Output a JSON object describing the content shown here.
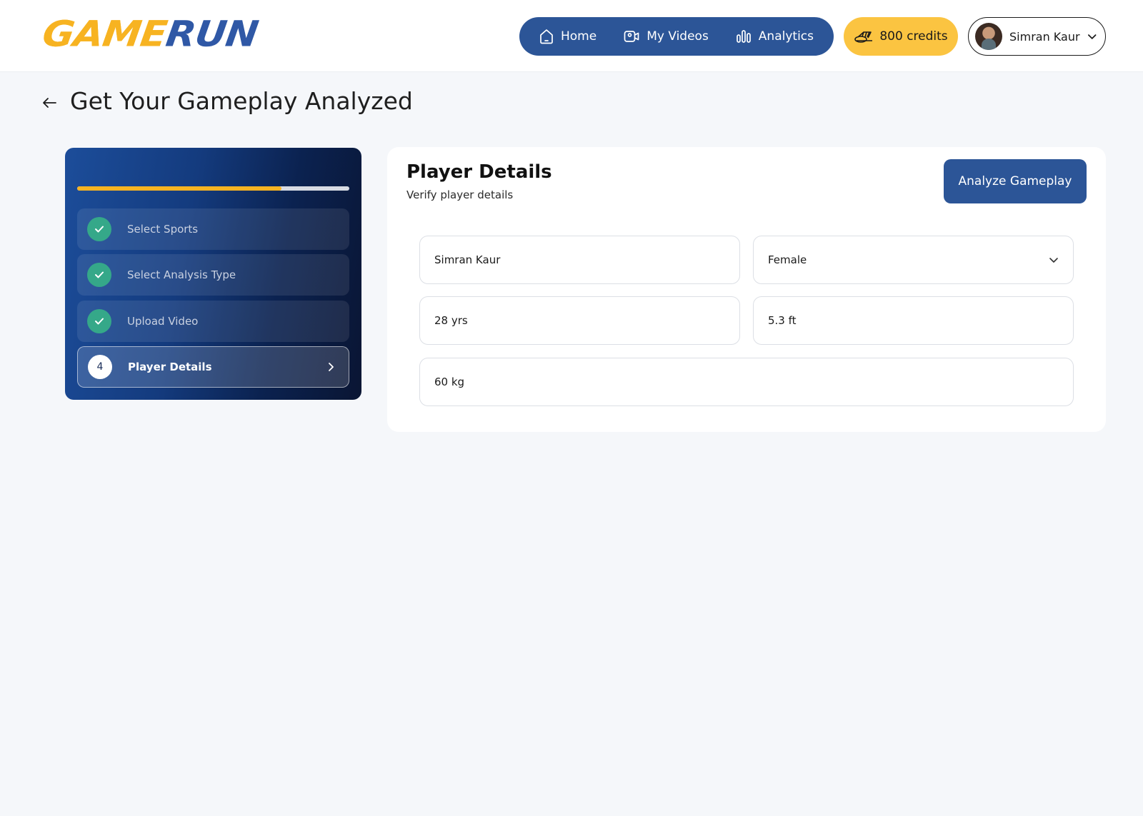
{
  "header": {
    "logo": {
      "part1": "GAME",
      "part2": "RUN"
    },
    "nav": [
      {
        "label": "Home",
        "icon": "home-icon"
      },
      {
        "label": "My Videos",
        "icon": "video-icon"
      },
      {
        "label": "Analytics",
        "icon": "analytics-icon"
      }
    ],
    "credits": {
      "label": "800 credits",
      "icon": "coins-icon"
    },
    "user": {
      "name": "Simran Kaur"
    }
  },
  "page": {
    "title": "Get Your Gameplay Analyzed"
  },
  "steps": {
    "progress_percent": 75,
    "items": [
      {
        "label": "Select Sports",
        "status": "done"
      },
      {
        "label": "Select Analysis Type",
        "status": "done"
      },
      {
        "label": "Upload Video",
        "status": "done"
      },
      {
        "number": "4",
        "label": "Player Details",
        "status": "active"
      }
    ]
  },
  "form": {
    "title": "Player Details",
    "subtitle": "Verify player details",
    "submit_label": "Analyze Gameplay",
    "fields": {
      "name": "Simran Kaur",
      "gender": "Female",
      "age": "28 yrs",
      "height": "5.3 ft",
      "weight": "60 kg"
    }
  },
  "colors": {
    "brand_yellow": "#f7b321",
    "brand_blue": "#2c5597",
    "done_green": "#35a889"
  }
}
